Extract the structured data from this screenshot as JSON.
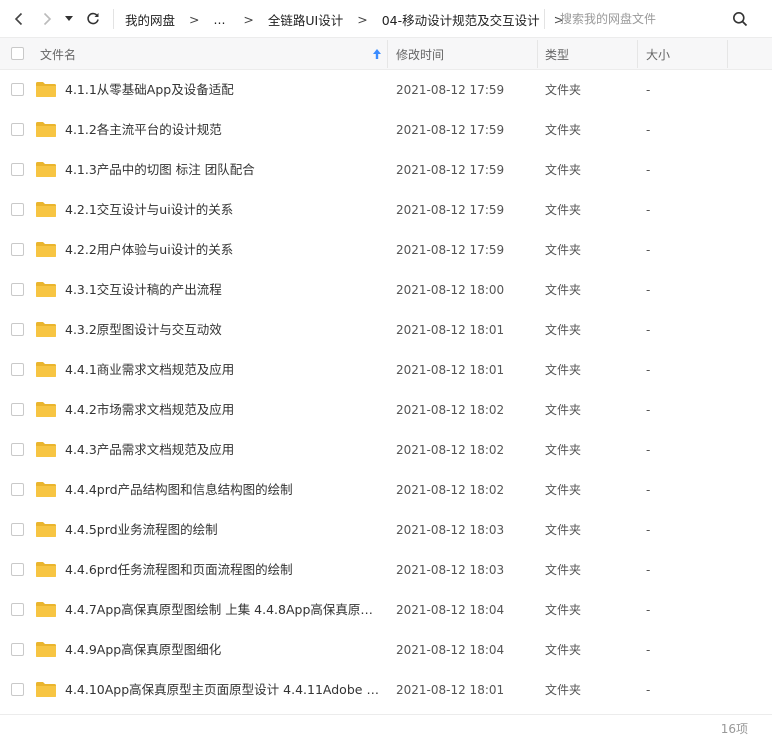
{
  "nav": {
    "back_icon": "chevron-left-icon",
    "forward_icon": "chevron-right-icon",
    "dropdown_icon": "caret-down-icon",
    "refresh_icon": "refresh-icon"
  },
  "breadcrumb": {
    "items": [
      "我的网盘",
      "...",
      "全链路UI设计",
      "04-移动设计规范及交互设计"
    ],
    "separator": ">"
  },
  "search": {
    "placeholder": "搜索我的网盘文件",
    "value": "",
    "icon": "search-icon"
  },
  "columns": {
    "name": "文件名",
    "modified": "修改时间",
    "type": "类型",
    "size": "大小",
    "sort_icon": "sort-arrow-up-icon"
  },
  "files": [
    {
      "name": "4.1.1从零基础App及设备适配",
      "modified": "2021-08-12 17:59",
      "type": "文件夹",
      "size": "-"
    },
    {
      "name": "4.1.2各主流平台的设计规范",
      "modified": "2021-08-12 17:59",
      "type": "文件夹",
      "size": "-"
    },
    {
      "name": "4.1.3产品中的切图 标注 团队配合",
      "modified": "2021-08-12 17:59",
      "type": "文件夹",
      "size": "-"
    },
    {
      "name": "4.2.1交互设计与ui设计的关系",
      "modified": "2021-08-12 17:59",
      "type": "文件夹",
      "size": "-"
    },
    {
      "name": "4.2.2用户体验与ui设计的关系",
      "modified": "2021-08-12 17:59",
      "type": "文件夹",
      "size": "-"
    },
    {
      "name": "4.3.1交互设计稿的产出流程",
      "modified": "2021-08-12 18:00",
      "type": "文件夹",
      "size": "-"
    },
    {
      "name": "4.3.2原型图设计与交互动效",
      "modified": "2021-08-12 18:01",
      "type": "文件夹",
      "size": "-"
    },
    {
      "name": "4.4.1商业需求文档规范及应用",
      "modified": "2021-08-12 18:01",
      "type": "文件夹",
      "size": "-"
    },
    {
      "name": "4.4.2市场需求文档规范及应用",
      "modified": "2021-08-12 18:02",
      "type": "文件夹",
      "size": "-"
    },
    {
      "name": "4.4.3产品需求文档规范及应用",
      "modified": "2021-08-12 18:02",
      "type": "文件夹",
      "size": "-"
    },
    {
      "name": "4.4.4prd产品结构图和信息结构图的绘制",
      "modified": "2021-08-12 18:02",
      "type": "文件夹",
      "size": "-"
    },
    {
      "name": "4.4.5prd业务流程图的绘制",
      "modified": "2021-08-12 18:03",
      "type": "文件夹",
      "size": "-"
    },
    {
      "name": "4.4.6prd任务流程图和页面流程图的绘制",
      "modified": "2021-08-12 18:03",
      "type": "文件夹",
      "size": "-"
    },
    {
      "name": "4.4.7App高保真原型图绘制 上集   4.4.8App高保真原型...",
      "modified": "2021-08-12 18:04",
      "type": "文件夹",
      "size": "-"
    },
    {
      "name": "4.4.9App高保真原型图细化",
      "modified": "2021-08-12 18:04",
      "type": "文件夹",
      "size": "-"
    },
    {
      "name": "4.4.10App高保真原型主页面原型设计   4.4.11Adobe XD...",
      "modified": "2021-08-12 18:01",
      "type": "文件夹",
      "size": "-"
    }
  ],
  "footer": {
    "count": "16项"
  },
  "colors": {
    "folder": "#f7c543",
    "folder_dark": "#eab52e",
    "sort_arrow": "#3b8cff"
  }
}
